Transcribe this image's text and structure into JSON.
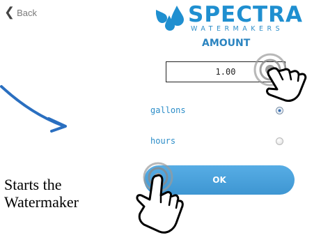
{
  "header": {
    "back_label": "Back",
    "logo": {
      "wordmark": "SPECTRA",
      "subtitle": "WATERMAKERS",
      "brand_color": "#1f8fd0"
    }
  },
  "amount": {
    "title": "AMOUNT",
    "value": "1.00"
  },
  "options": [
    {
      "label": "gallons",
      "selected": true
    },
    {
      "label": "hours",
      "selected": false
    }
  ],
  "ok_button": {
    "label": "OK",
    "color": "#4aa1dc"
  },
  "annotation": {
    "line1": "Starts the",
    "line2": "Watermaker",
    "arrow_color": "#2a6fc0"
  }
}
